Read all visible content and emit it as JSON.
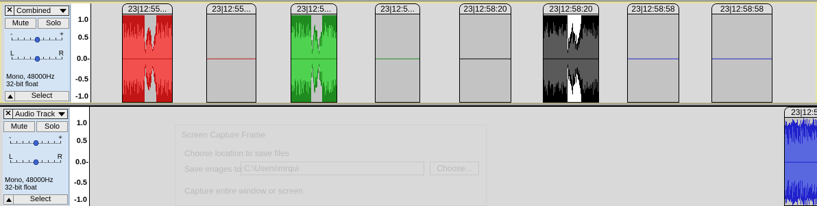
{
  "colors": {
    "selected_track_border": "#e7e3a6",
    "red": "#c21515",
    "red_light": "#f24f4f",
    "green": "#1f8a1f",
    "green_light": "#4fd24f",
    "black": "#000000",
    "gray_light": "#5a5a5a",
    "blue": "#2222cc",
    "blue_light": "#5a68e0"
  },
  "tracks": [
    {
      "name": "Combined",
      "mute_label": "Mute",
      "solo_label": "Solo",
      "gain_minus": "-",
      "gain_plus": "+",
      "pan_left": "L",
      "pan_right": "R",
      "info_line1": "Mono, 48000Hz",
      "info_line2": "32-bit float",
      "select_label": "Select",
      "ruler_labels": [
        "1.0",
        "0.5",
        "0.0-",
        "-0.5",
        "-1.0"
      ],
      "clips": [
        {
          "title": "23|12:55...",
          "color": "red",
          "kind": "wave"
        },
        {
          "title": "23|12:55...",
          "color": "red",
          "kind": "flat"
        },
        {
          "title": "23|12:5...",
          "color": "green",
          "kind": "wave"
        },
        {
          "title": "23|12:5...",
          "color": "green",
          "kind": "flat"
        },
        {
          "title": "23|12:58:20",
          "color": "black",
          "kind": "flat"
        },
        {
          "title": "23|12:58:20",
          "color": "black",
          "kind": "wave"
        },
        {
          "title": "23|12:58:58",
          "color": "blue",
          "kind": "flat"
        },
        {
          "title": "23|12:58:58",
          "color": "blue",
          "kind": "flat"
        }
      ]
    },
    {
      "name": "Audio Track",
      "mute_label": "Mute",
      "solo_label": "Solo",
      "gain_minus": "-",
      "gain_plus": "+",
      "pan_left": "L",
      "pan_right": "R",
      "info_line1": "Mono, 48000Hz",
      "info_line2": "32-bit float",
      "select_label": "Select",
      "ruler_labels": [
        "1.0",
        "0.5",
        "0.0-",
        "-0.5",
        "-1.0"
      ],
      "clips": [
        {
          "title": "23|12:5",
          "color": "blue",
          "kind": "wave"
        }
      ]
    }
  ],
  "dialog_ghost": {
    "title": "Screen Capture Frame",
    "line1": "Choose location to save files",
    "save_label": "Save images to:",
    "path_value": "C:\\Users\\mrqui",
    "choose_button": "Choose...",
    "line2": "Capture entire window or screen"
  },
  "close_glyph": "✕"
}
